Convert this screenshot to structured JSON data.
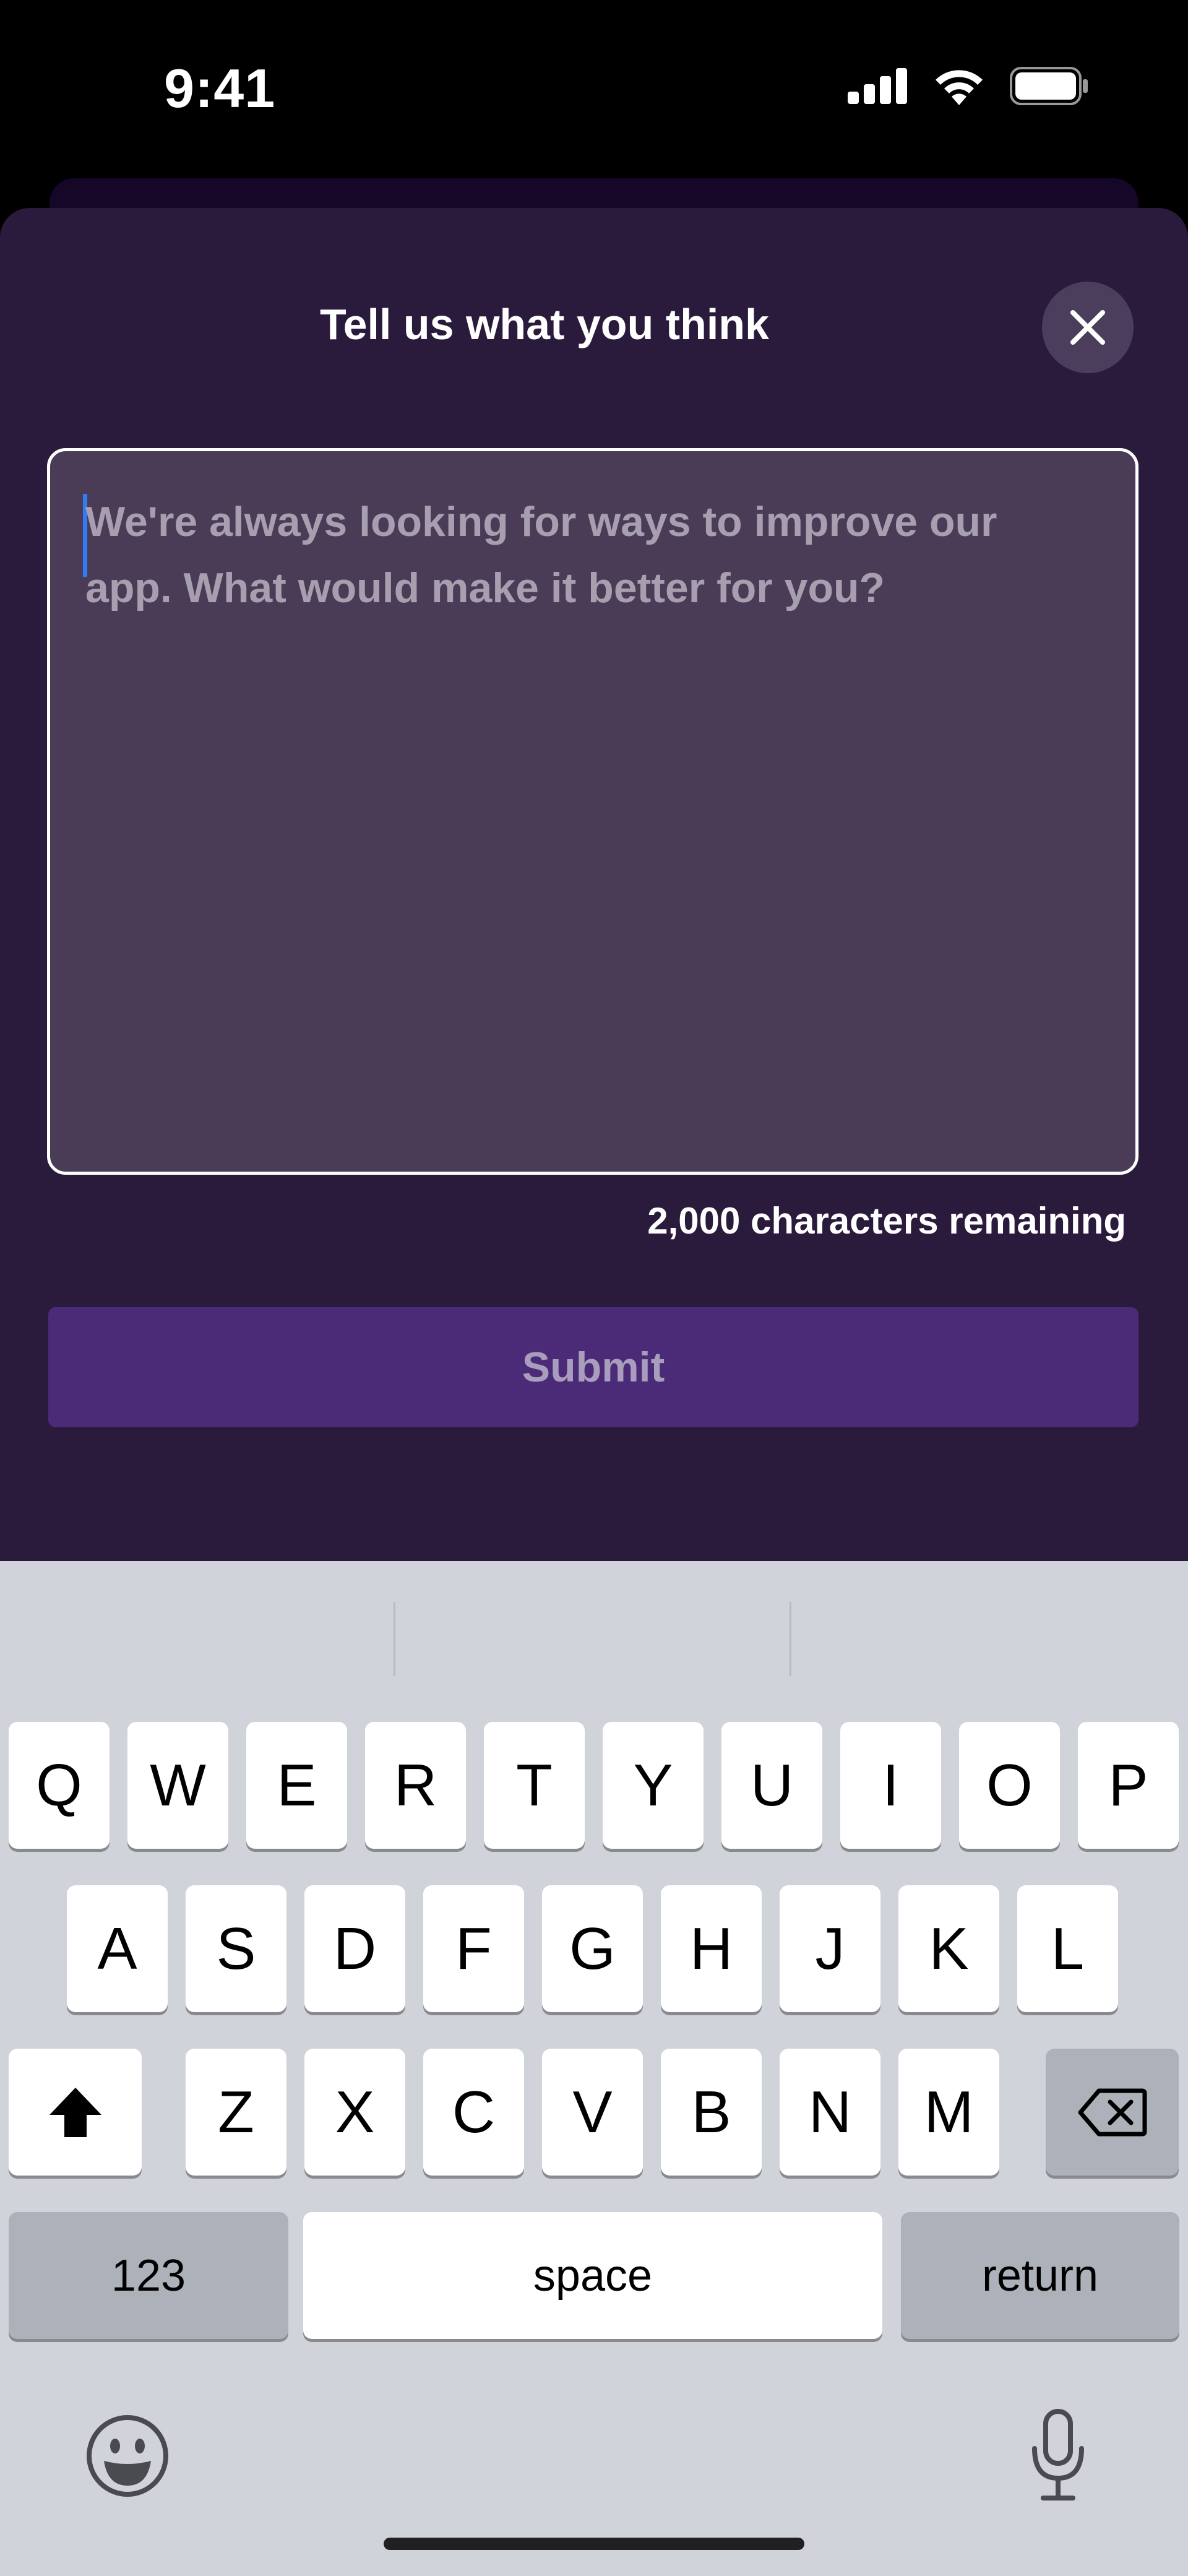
{
  "status_bar": {
    "time": "9:41",
    "icons": [
      "cellular-signal-icon",
      "wifi-icon",
      "battery-icon"
    ]
  },
  "sheet": {
    "title": "Tell us what you think",
    "close_icon": "close-icon",
    "feedback": {
      "value": "",
      "placeholder": "We're always looking for ways to improve our app. What would make it better for you?"
    },
    "counter": "2,000 characters remaining",
    "submit_label": "Submit"
  },
  "keyboard": {
    "row1": [
      "Q",
      "W",
      "E",
      "R",
      "T",
      "Y",
      "U",
      "I",
      "O",
      "P"
    ],
    "row2": [
      "A",
      "S",
      "D",
      "F",
      "G",
      "H",
      "J",
      "K",
      "L"
    ],
    "row3": [
      "Z",
      "X",
      "C",
      "V",
      "B",
      "N",
      "M"
    ],
    "shift_icon": "shift-icon",
    "delete_icon": "delete-icon",
    "numbers_label": "123",
    "space_label": "space",
    "return_label": "return",
    "emoji_icon": "emoji-icon",
    "mic_icon": "microphone-icon"
  },
  "colors": {
    "sheet_bg": "#2a1b3d",
    "textarea_bg": "#4a3c57",
    "submit_bg": "#4b2a78",
    "caret": "#2f7cf6",
    "keyboard_bg": "#d1d3da"
  }
}
